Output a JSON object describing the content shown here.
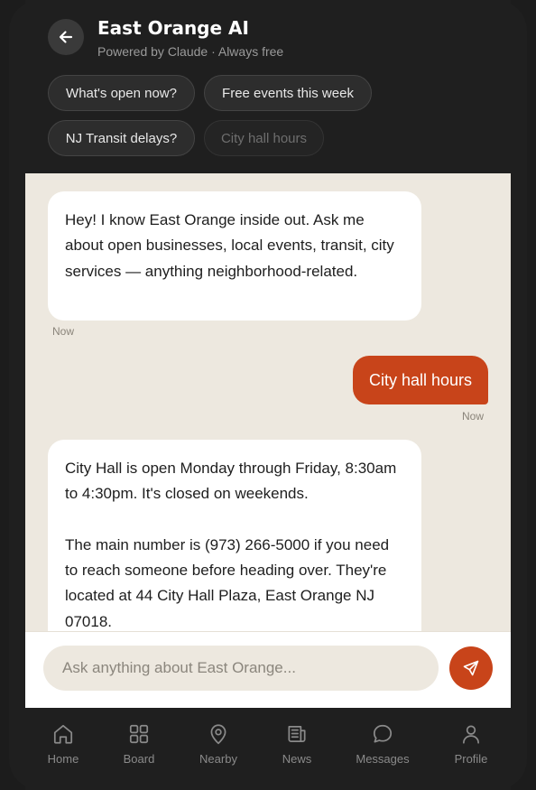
{
  "header": {
    "title": "East Orange AI",
    "subtitle": "Powered by Claude · Always free",
    "chips": [
      {
        "label": "What's open now?"
      },
      {
        "label": "Free events this week"
      },
      {
        "label": "NJ Transit delays?"
      },
      {
        "label": "City hall hours"
      }
    ]
  },
  "chat": {
    "messages": [
      {
        "role": "bot",
        "text": "Hey! I know East Orange inside out. Ask me about open businesses, local events, transit, city services — anything neighborhood-related.",
        "time": "Now"
      },
      {
        "role": "user",
        "text": "City hall hours",
        "time": "Now"
      },
      {
        "role": "bot",
        "paragraphs": [
          "City Hall is open Monday through Friday, 8:30am to 4:30pm. It's closed on weekends.",
          "The main number is (973) 266-5000 if you need to reach someone before heading over. They're located at 44 City Hall Plaza, East Orange NJ 07018."
        ]
      }
    ]
  },
  "input": {
    "placeholder": "Ask anything about East Orange...",
    "value": ""
  },
  "nav": {
    "items": [
      {
        "label": "Home",
        "icon": "home-icon"
      },
      {
        "label": "Board",
        "icon": "grid-icon"
      },
      {
        "label": "Nearby",
        "icon": "map-pin-icon"
      },
      {
        "label": "News",
        "icon": "newspaper-icon"
      },
      {
        "label": "Messages",
        "icon": "chat-bubble-icon"
      },
      {
        "label": "Profile",
        "icon": "user-icon"
      }
    ]
  },
  "colors": {
    "accent": "#c8441a",
    "chat_background": "#ede8df",
    "dark_background": "#1f1f1f"
  }
}
